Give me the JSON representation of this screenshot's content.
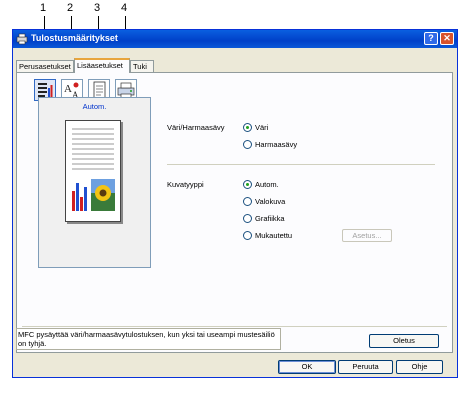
{
  "callouts": [
    "1",
    "2",
    "3",
    "4"
  ],
  "window": {
    "title": "Tulostusmääritykset",
    "help_glyph": "?",
    "close_glyph": "✕"
  },
  "tabs": [
    {
      "label": "Perusasetukset"
    },
    {
      "label": "Lisäasetukset"
    },
    {
      "label": "Tuki"
    }
  ],
  "toolbar": {
    "icons": [
      "color-greyscale-icon",
      "watermark-icon",
      "page-setting-icon",
      "device-options-icon"
    ]
  },
  "preview": {
    "label": "Autom."
  },
  "color_section": {
    "label": "Väri/Harmaasävy",
    "options": [
      {
        "label": "Väri",
        "selected": true
      },
      {
        "label": "Harmaasävy",
        "selected": false
      }
    ]
  },
  "image_section": {
    "label": "Kuvatyyppi",
    "options": [
      {
        "label": "Autom.",
        "selected": true
      },
      {
        "label": "Valokuva",
        "selected": false
      },
      {
        "label": "Grafiikka",
        "selected": false
      },
      {
        "label": "Mukautettu",
        "selected": false
      }
    ],
    "settings_button": "Asetus..."
  },
  "status": {
    "text": "MFC pysäyttää väri/harmaasävytulostuksen, kun yksi tai useampi mustesäiliö on tyhjä."
  },
  "buttons": {
    "default": "Oletus",
    "ok": "OK",
    "cancel": "Peruuta",
    "help": "Ohje"
  }
}
